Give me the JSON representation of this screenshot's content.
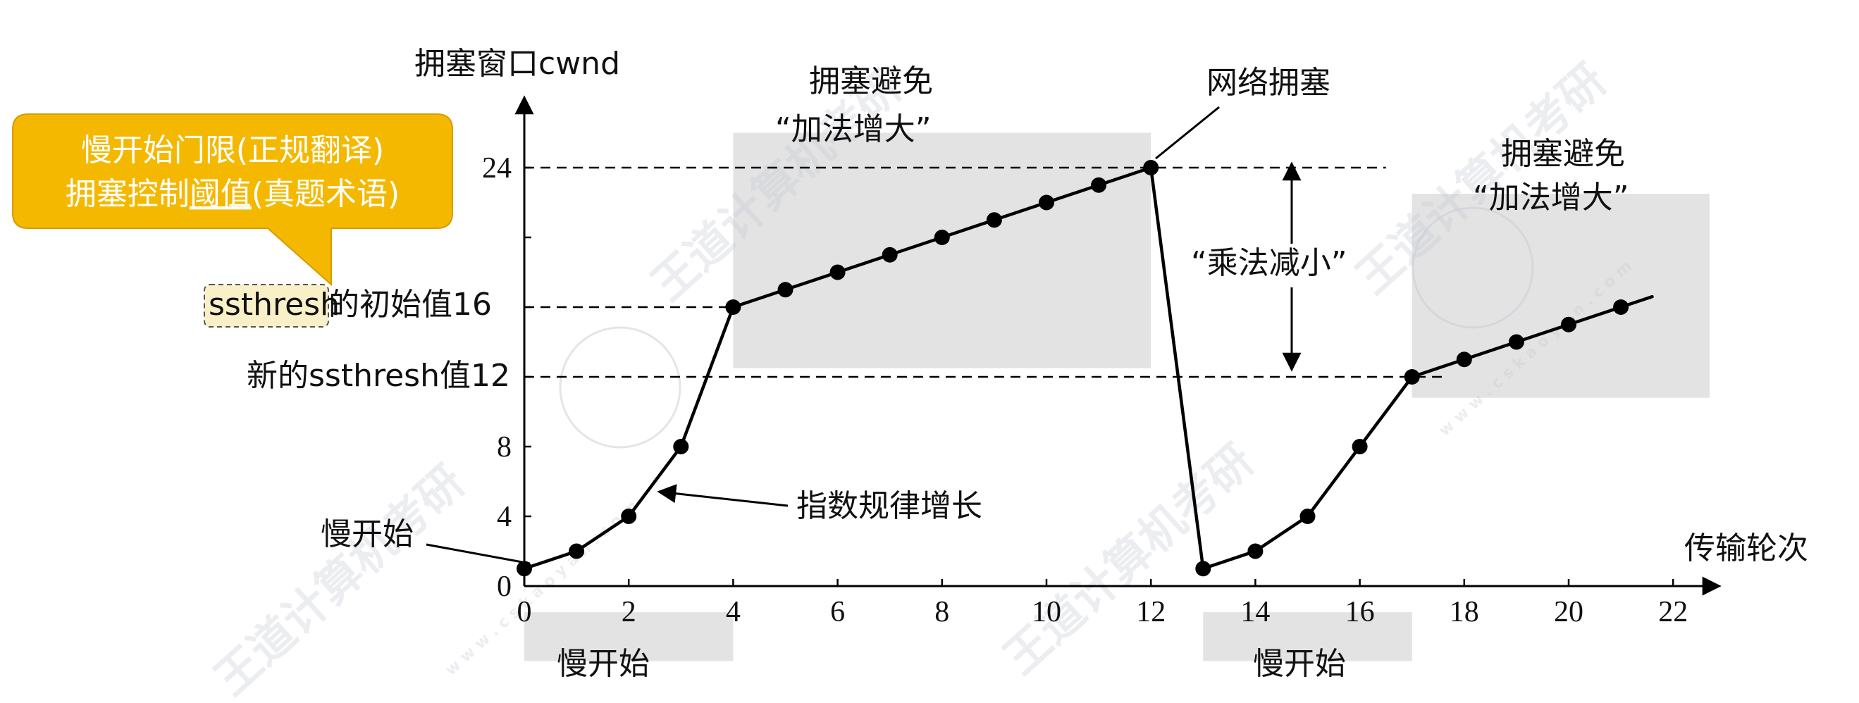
{
  "chart_data": {
    "type": "line",
    "title": "",
    "ylabel": "拥塞窗口cwnd",
    "xlabel": "传输轮次",
    "xlim": [
      0,
      23
    ],
    "ylim": [
      0,
      27
    ],
    "x_ticks": [
      0,
      2,
      4,
      6,
      8,
      10,
      12,
      14,
      16,
      18,
      20,
      22
    ],
    "y_ticks": [
      "0",
      "4",
      "8",
      "",
      "",
      "",
      "24"
    ],
    "y_tick_values": [
      0,
      4,
      8,
      12,
      16,
      20,
      24
    ],
    "series": [
      {
        "x": [
          0,
          1,
          2,
          3,
          4,
          5,
          6,
          7,
          8,
          9,
          10,
          11,
          12
        ],
        "y": [
          1,
          2,
          4,
          8,
          16,
          17,
          18,
          19,
          20,
          21,
          22,
          23,
          24
        ]
      },
      {
        "x": [
          13,
          14,
          15,
          16,
          17,
          18,
          19,
          20,
          21
        ],
        "y": [
          1,
          2,
          4,
          8,
          12,
          13,
          14,
          15,
          16
        ]
      }
    ],
    "drop_line": {
      "from": [
        12,
        24
      ],
      "to": [
        13,
        1
      ]
    },
    "tail_line": {
      "from": [
        21,
        16
      ],
      "to": [
        21.6,
        16.6
      ]
    },
    "dashed_levels": [
      {
        "y": 24,
        "x_end": 16.5
      },
      {
        "y": 16,
        "x_end": 4
      },
      {
        "y": 12,
        "x_end": 17.6
      }
    ],
    "shaded_regions": [
      {
        "name": "ca-1",
        "x0": 4,
        "x1": 12,
        "y0": 12.5,
        "y1": 26
      },
      {
        "name": "ca-2",
        "x0": 17,
        "x1": 22.7,
        "y0": 10.8,
        "y1": 22.5
      },
      {
        "name": "ss-1",
        "x0": 0,
        "x1": 4,
        "y0": -4.3,
        "y1": -1.5
      },
      {
        "name": "ss-2",
        "x0": 13,
        "x1": 17,
        "y0": -4.3,
        "y1": -1.5
      }
    ],
    "annotations": {
      "ssthresh_init_word": "ssthresh",
      "ssthresh_init_rest": "的初始值16",
      "new_ssthresh": "新的ssthresh值12",
      "slow_start_label": "慢开始",
      "exp_growth": "指数规律增长",
      "congestion": "网络拥塞",
      "ca_title": "拥塞避免",
      "ca_sub": "“加法增大”",
      "mult_decrease": "“乘法减小”",
      "ss_box": "慢开始"
    }
  },
  "callout": {
    "line1": "慢开始门限(正规翻译)",
    "line2_prefix": "拥塞控制",
    "line2_underlined": "阈值",
    "line2_suffix": "(真题术语)",
    "color": "#F5B800"
  },
  "watermark": {
    "text": "王道计算机考研",
    "url_text": "w w w . c s k a o y a n . c o m"
  },
  "colors": {
    "line": "#000000",
    "shade": "#e3e3e3",
    "callout": "#F5B800",
    "highlight": "#faf0c8"
  }
}
